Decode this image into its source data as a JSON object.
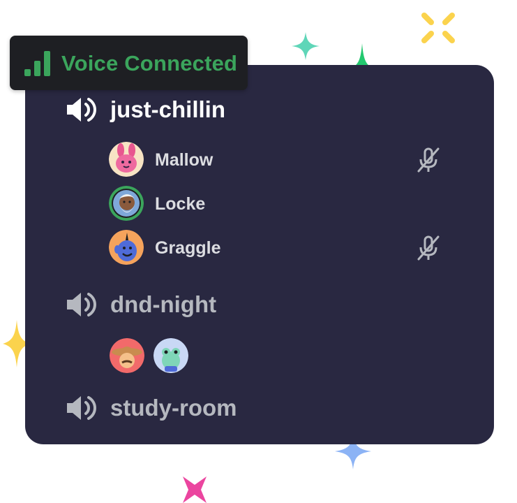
{
  "voice_status": {
    "label": "Voice Connected",
    "color": "#3ba55c",
    "icon": "signal-bars-icon"
  },
  "channels": [
    {
      "name": "just-chillin",
      "icon": "speaker-icon",
      "active": true,
      "users": [
        {
          "name": "Mallow",
          "muted": true,
          "speaking": false,
          "avatar": "pink-bunny-avatar"
        },
        {
          "name": "Locke",
          "muted": false,
          "speaking": true,
          "avatar": "bearded-man-avatar"
        },
        {
          "name": "Graggle",
          "muted": true,
          "speaking": false,
          "avatar": "blue-genie-avatar"
        }
      ]
    },
    {
      "name": "dnd-night",
      "icon": "speaker-icon",
      "active": false,
      "preview_avatars": [
        "cowboy-avatar",
        "frog-avatar"
      ]
    },
    {
      "name": "study-room",
      "icon": "speaker-icon",
      "active": false
    }
  ],
  "colors": {
    "panel": "#292841",
    "badge": "#1e1f23",
    "active_text": "#ffffff",
    "idle_text": "#b5b8bf",
    "speaking_ring": "#3ba55c"
  }
}
